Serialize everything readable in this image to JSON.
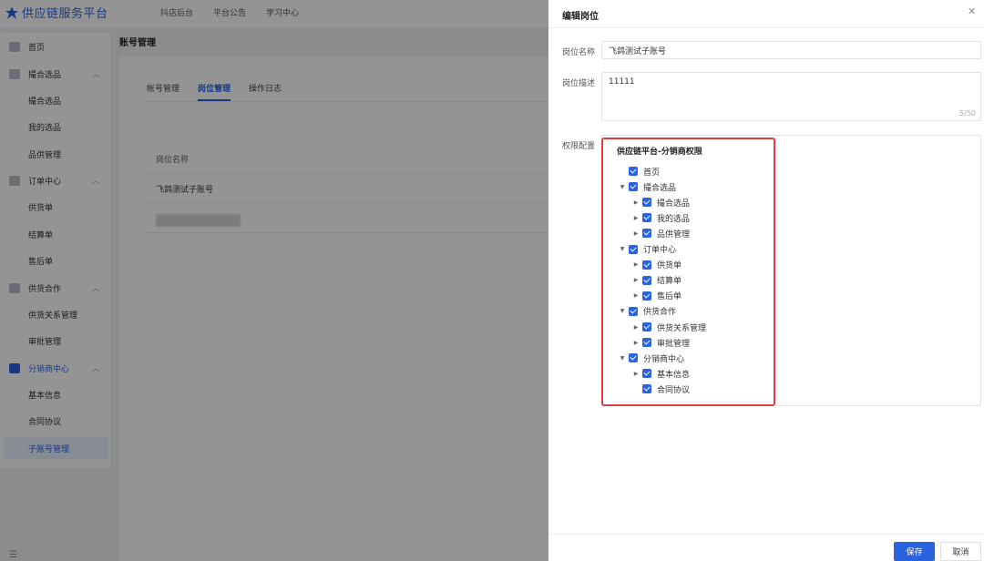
{
  "app": {
    "title": "供应链服务平台",
    "top_nav": [
      "抖店后台",
      "平台公告",
      "学习中心"
    ]
  },
  "sidebar": {
    "items": [
      {
        "label": "首页",
        "icon": "home-icon",
        "expandable": false
      },
      {
        "label": "撮合选品",
        "icon": "mail-icon",
        "expandable": true
      },
      {
        "label": "撮合选品",
        "sub": true
      },
      {
        "label": "我的选品",
        "sub": true
      },
      {
        "label": "品供管理",
        "sub": true
      },
      {
        "label": "订单中心",
        "icon": "order-icon",
        "expandable": true
      },
      {
        "label": "供货单",
        "sub": true
      },
      {
        "label": "结算单",
        "sub": true
      },
      {
        "label": "售后单",
        "sub": true
      },
      {
        "label": "供货合作",
        "icon": "user-icon",
        "expandable": true
      },
      {
        "label": "供货关系管理",
        "sub": true
      },
      {
        "label": "审批管理",
        "sub": true
      },
      {
        "label": "分销商中心",
        "icon": "distributor-icon",
        "expandable": true
      },
      {
        "label": "基本信息",
        "sub": true
      },
      {
        "label": "合同协议",
        "sub": true
      },
      {
        "label": "子账号管理",
        "sub": true,
        "active": true
      }
    ]
  },
  "main": {
    "title": "账号管理",
    "tabs": [
      "帐号管理",
      "岗位管理",
      "操作日志"
    ],
    "active_tab": "岗位管理",
    "table": {
      "header": "岗位名称",
      "rows": [
        "飞鸽测试子账号"
      ]
    }
  },
  "drawer": {
    "title": "编辑岗位",
    "fields": {
      "name_label": "岗位名称",
      "name_value": "飞鸽测试子账号",
      "desc_label": "岗位描述",
      "desc_value": "11111",
      "desc_count": "5/50",
      "perm_label": "权限配置"
    },
    "permission_tree": {
      "title": "供应链平台-分销商权限",
      "nodes": [
        {
          "label": "首页",
          "level": 0,
          "caret": "none",
          "checked": true
        },
        {
          "label": "撮合选品",
          "level": 0,
          "caret": "down",
          "checked": true
        },
        {
          "label": "撮合选品",
          "level": 1,
          "caret": "right",
          "checked": true
        },
        {
          "label": "我的选品",
          "level": 1,
          "caret": "right",
          "checked": true
        },
        {
          "label": "品供管理",
          "level": 1,
          "caret": "right",
          "checked": true
        },
        {
          "label": "订单中心",
          "level": 0,
          "caret": "down",
          "checked": true
        },
        {
          "label": "供货单",
          "level": 1,
          "caret": "right",
          "checked": true
        },
        {
          "label": "结算单",
          "level": 1,
          "caret": "right",
          "checked": true
        },
        {
          "label": "售后单",
          "level": 1,
          "caret": "right",
          "checked": true
        },
        {
          "label": "供货合作",
          "level": 0,
          "caret": "down",
          "checked": true
        },
        {
          "label": "供货关系管理",
          "level": 1,
          "caret": "right",
          "checked": true
        },
        {
          "label": "审批管理",
          "level": 1,
          "caret": "right",
          "checked": true
        },
        {
          "label": "分销商中心",
          "level": 0,
          "caret": "down",
          "checked": true
        },
        {
          "label": "基本信息",
          "level": 1,
          "caret": "right",
          "checked": true
        },
        {
          "label": "合同协议",
          "level": 1,
          "caret": "none",
          "checked": true
        }
      ]
    },
    "buttons": {
      "save": "保存",
      "cancel": "取消"
    }
  },
  "colors": {
    "primary": "#2a63e0",
    "highlight_frame": "#e03e3e",
    "overlay": "rgba(0,0,0,0.42)"
  }
}
